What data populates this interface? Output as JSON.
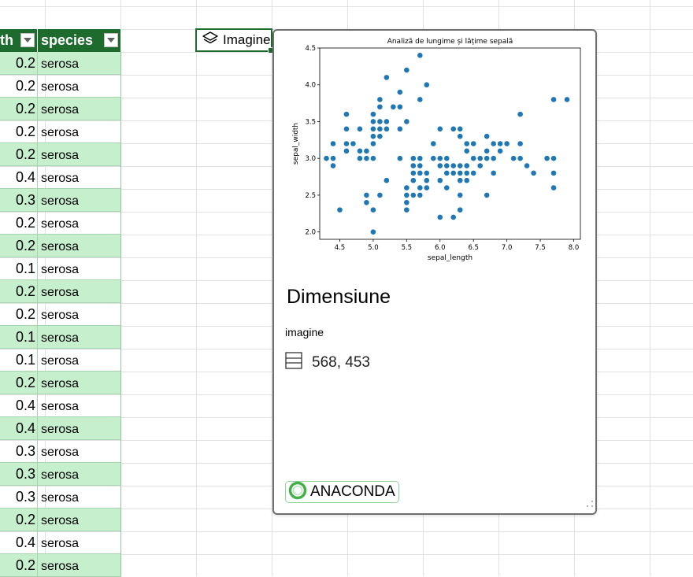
{
  "table": {
    "header_col1": "th",
    "header_col2": "species",
    "rows": [
      {
        "v": "0.2",
        "s": "serosa"
      },
      {
        "v": "0.2",
        "s": "serosa"
      },
      {
        "v": "0.2",
        "s": "serosa"
      },
      {
        "v": "0.2",
        "s": "serosa"
      },
      {
        "v": "0.2",
        "s": "serosa"
      },
      {
        "v": "0.4",
        "s": "serosa"
      },
      {
        "v": "0.3",
        "s": "serosa"
      },
      {
        "v": "0.2",
        "s": "serosa"
      },
      {
        "v": "0.2",
        "s": "serosa"
      },
      {
        "v": "0.1",
        "s": "serosa"
      },
      {
        "v": "0.2",
        "s": "serosa"
      },
      {
        "v": "0.2",
        "s": "serosa"
      },
      {
        "v": "0.1",
        "s": "serosa"
      },
      {
        "v": "0.1",
        "s": "serosa"
      },
      {
        "v": "0.2",
        "s": "serosa"
      },
      {
        "v": "0.4",
        "s": "serosa"
      },
      {
        "v": "0.4",
        "s": "serosa"
      },
      {
        "v": "0.3",
        "s": "serosa"
      },
      {
        "v": "0.3",
        "s": "serosa"
      },
      {
        "v": "0.3",
        "s": "serosa"
      },
      {
        "v": "0.2",
        "s": "serosa"
      },
      {
        "v": "0.4",
        "s": "serosa"
      },
      {
        "v": "0.2",
        "s": "serosa"
      }
    ]
  },
  "cell": {
    "label": "Imagine",
    "icon": "layers-icon"
  },
  "card": {
    "title": "Dimensiune",
    "subtitle": "imagine",
    "dimensions": "568, 453",
    "dimensions_icon": "table-icon",
    "badge": "ANACONDA"
  },
  "colors": {
    "header_green": "#1e6b2e",
    "row_alt": "#c6efce",
    "point": "#1f77b4"
  },
  "chart_data": {
    "type": "scatter",
    "title": "Analiză de lungime și lățime sepală",
    "xlabel": "sepal_length",
    "ylabel": "sepal_width",
    "xlim": [
      4.2,
      8.1
    ],
    "ylim": [
      1.9,
      4.5
    ],
    "xticks": [
      "4.5",
      "5.0",
      "5.5",
      "6.0",
      "6.5",
      "7.0",
      "7.5",
      "8.0"
    ],
    "yticks": [
      "2.0",
      "2.5",
      "3.0",
      "3.5",
      "4.0",
      "4.5"
    ],
    "points": [
      [
        4.3,
        3.0
      ],
      [
        4.4,
        2.9
      ],
      [
        4.4,
        3.0
      ],
      [
        4.4,
        3.2
      ],
      [
        4.5,
        2.3
      ],
      [
        4.6,
        3.1
      ],
      [
        4.6,
        3.2
      ],
      [
        4.6,
        3.4
      ],
      [
        4.6,
        3.6
      ],
      [
        4.7,
        3.2
      ],
      [
        4.8,
        3.0
      ],
      [
        4.8,
        3.1
      ],
      [
        4.8,
        3.4
      ],
      [
        4.9,
        2.4
      ],
      [
        4.9,
        2.5
      ],
      [
        4.9,
        3.0
      ],
      [
        4.9,
        3.1
      ],
      [
        5.0,
        2.0
      ],
      [
        5.0,
        2.3
      ],
      [
        5.0,
        3.0
      ],
      [
        5.0,
        3.2
      ],
      [
        5.0,
        3.3
      ],
      [
        5.0,
        3.4
      ],
      [
        5.0,
        3.5
      ],
      [
        5.0,
        3.6
      ],
      [
        5.1,
        2.5
      ],
      [
        5.1,
        3.3
      ],
      [
        5.1,
        3.4
      ],
      [
        5.1,
        3.5
      ],
      [
        5.1,
        3.7
      ],
      [
        5.1,
        3.8
      ],
      [
        5.2,
        2.7
      ],
      [
        5.2,
        3.4
      ],
      [
        5.2,
        3.5
      ],
      [
        5.2,
        4.1
      ],
      [
        5.3,
        3.7
      ],
      [
        5.4,
        3.0
      ],
      [
        5.4,
        3.4
      ],
      [
        5.4,
        3.7
      ],
      [
        5.4,
        3.9
      ],
      [
        5.5,
        2.3
      ],
      [
        5.5,
        2.4
      ],
      [
        5.5,
        2.5
      ],
      [
        5.5,
        2.6
      ],
      [
        5.5,
        3.5
      ],
      [
        5.5,
        4.2
      ],
      [
        5.6,
        2.5
      ],
      [
        5.6,
        2.7
      ],
      [
        5.6,
        2.8
      ],
      [
        5.6,
        2.9
      ],
      [
        5.6,
        3.0
      ],
      [
        5.7,
        2.5
      ],
      [
        5.7,
        2.6
      ],
      [
        5.7,
        2.8
      ],
      [
        5.7,
        2.9
      ],
      [
        5.7,
        3.0
      ],
      [
        5.7,
        3.8
      ],
      [
        5.7,
        4.4
      ],
      [
        5.8,
        2.6
      ],
      [
        5.8,
        2.7
      ],
      [
        5.8,
        2.8
      ],
      [
        5.8,
        4.0
      ],
      [
        5.9,
        3.0
      ],
      [
        5.9,
        3.2
      ],
      [
        6.0,
        2.2
      ],
      [
        6.0,
        2.7
      ],
      [
        6.0,
        2.9
      ],
      [
        6.0,
        3.0
      ],
      [
        6.0,
        3.4
      ],
      [
        6.1,
        2.6
      ],
      [
        6.1,
        2.8
      ],
      [
        6.1,
        2.9
      ],
      [
        6.1,
        3.0
      ],
      [
        6.2,
        2.2
      ],
      [
        6.2,
        2.8
      ],
      [
        6.2,
        2.9
      ],
      [
        6.2,
        3.4
      ],
      [
        6.3,
        2.3
      ],
      [
        6.3,
        2.5
      ],
      [
        6.3,
        2.7
      ],
      [
        6.3,
        2.8
      ],
      [
        6.3,
        2.9
      ],
      [
        6.3,
        3.3
      ],
      [
        6.3,
        3.4
      ],
      [
        6.4,
        2.7
      ],
      [
        6.4,
        2.8
      ],
      [
        6.4,
        2.9
      ],
      [
        6.4,
        3.1
      ],
      [
        6.4,
        3.2
      ],
      [
        6.5,
        2.8
      ],
      [
        6.5,
        3.0
      ],
      [
        6.5,
        3.2
      ],
      [
        6.6,
        2.9
      ],
      [
        6.6,
        3.0
      ],
      [
        6.7,
        2.5
      ],
      [
        6.7,
        3.0
      ],
      [
        6.7,
        3.1
      ],
      [
        6.7,
        3.3
      ],
      [
        6.8,
        2.8
      ],
      [
        6.8,
        3.0
      ],
      [
        6.8,
        3.2
      ],
      [
        6.9,
        3.1
      ],
      [
        6.9,
        3.2
      ],
      [
        7.0,
        3.2
      ],
      [
        7.1,
        3.0
      ],
      [
        7.2,
        3.0
      ],
      [
        7.2,
        3.2
      ],
      [
        7.2,
        3.6
      ],
      [
        7.3,
        2.9
      ],
      [
        7.4,
        2.8
      ],
      [
        7.6,
        3.0
      ],
      [
        7.7,
        2.6
      ],
      [
        7.7,
        2.8
      ],
      [
        7.7,
        3.0
      ],
      [
        7.7,
        3.8
      ],
      [
        7.9,
        3.8
      ]
    ],
    "grid": false
  }
}
